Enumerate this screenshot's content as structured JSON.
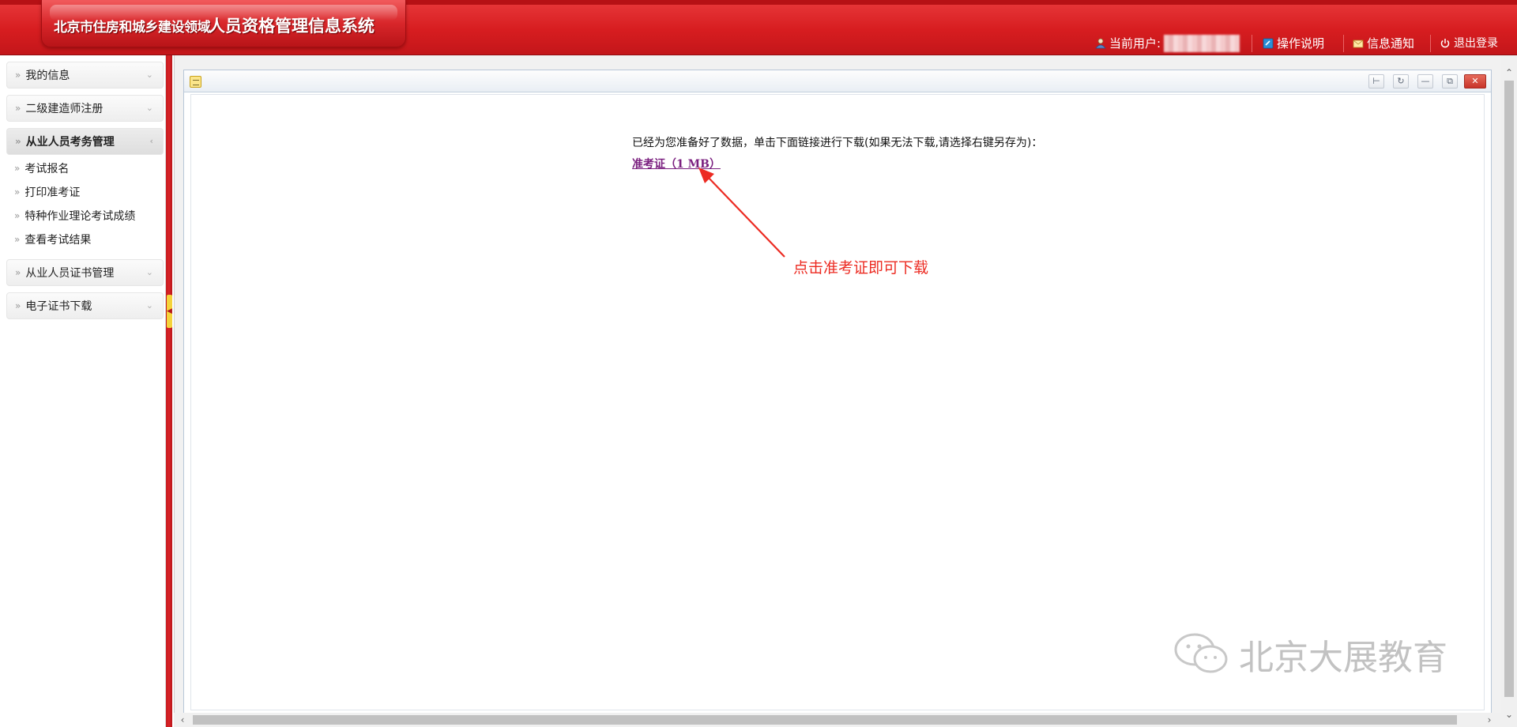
{
  "header": {
    "subtitle": "北京市住房和城乡建设领域",
    "title": "人员资格管理信息系统",
    "current_user_label": "当前用户:",
    "help_label": "操作说明",
    "notice_label": "信息通知",
    "logout_label": "退出登录"
  },
  "sidebar": {
    "groups": [
      {
        "label": "我的信息"
      },
      {
        "label": "二级建造师注册"
      },
      {
        "label": "从业人员考务管理"
      },
      {
        "label": "从业人员证书管理"
      },
      {
        "label": "电子证书下载"
      }
    ],
    "sub_items": [
      {
        "label": "考试报名"
      },
      {
        "label": "打印准考证"
      },
      {
        "label": "特种作业理论考试成绩"
      },
      {
        "label": "查看考试结果"
      }
    ]
  },
  "content": {
    "download_instruction": "已经为您准备好了数据，单击下面链接进行下载(如果无法下载,请选择右键另存为)：",
    "download_link": "准考证（1 MB）",
    "annotation": "点击准考证即可下载"
  },
  "watermark": {
    "text": "北京大展教育"
  },
  "icons": {
    "user": "user-icon",
    "help": "help-book-icon",
    "notice": "envelope-icon",
    "logout": "power-icon",
    "panel": "notepad-icon"
  },
  "colors": {
    "header_red": "#d71d20",
    "link_purple": "#7a1f7f",
    "annotation_red": "#ec2b22"
  }
}
